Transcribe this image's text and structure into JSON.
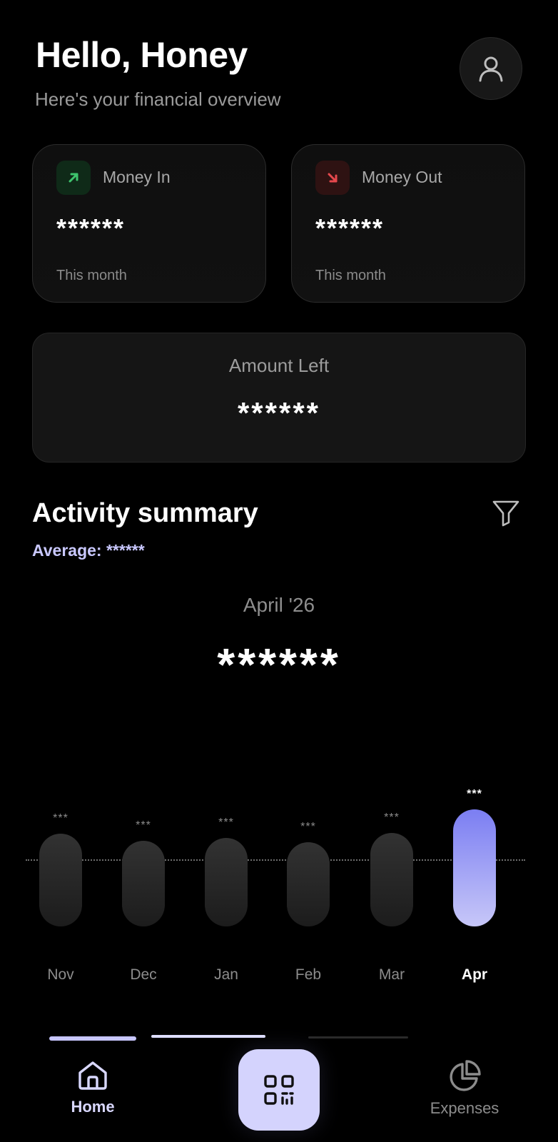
{
  "header": {
    "greeting": "Hello, Honey",
    "subtitle": "Here's your financial overview",
    "avatar_icon": "user-icon"
  },
  "money_in": {
    "icon": "arrow-up-right-icon",
    "label": "Money In",
    "value": "******",
    "period": "This month",
    "accent": "#3ec46d"
  },
  "money_out": {
    "icon": "arrow-down-right-icon",
    "label": "Money Out",
    "value": "******",
    "period": "This month",
    "accent": "#e5484d"
  },
  "amount_left": {
    "label": "Amount Left",
    "value": "******"
  },
  "activity": {
    "title": "Activity summary",
    "average": "Average: ******",
    "filter_icon": "filter-icon",
    "selected_period": "April '26",
    "selected_value": "******"
  },
  "chart_data": {
    "type": "bar",
    "categories": [
      "Nov",
      "Dec",
      "Jan",
      "Feb",
      "Mar",
      "Apr"
    ],
    "value_labels": [
      "***",
      "***",
      "***",
      "***",
      "***",
      "***"
    ],
    "selected": "Apr",
    "accent": "#7b7ef2"
  },
  "nav": {
    "home_label": "Home",
    "home_icon": "home-icon",
    "scan_icon": "qr-code-icon",
    "expenses_label": "Expenses",
    "expenses_icon": "pie-chart-icon"
  }
}
